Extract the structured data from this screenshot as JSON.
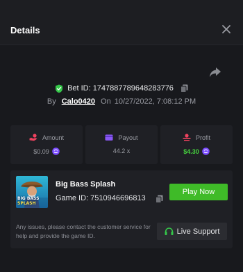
{
  "dialog": {
    "title": "Details",
    "close_icon": "close-icon"
  },
  "bet": {
    "label": "Bet ID:",
    "id": "1747887789648283776",
    "by_label": "By",
    "user": "Calo0420",
    "on_label": "On",
    "date": "10/27/2022, 7:08:12 PM",
    "icons": [
      "shield-check-icon",
      "copy-icon",
      "share-icon"
    ]
  },
  "stats": {
    "amount": {
      "label": "Amount",
      "value": "$0.09",
      "icon": "hand-coins-icon"
    },
    "payout": {
      "label": "Payout",
      "value": "44.2 x",
      "icon": "wallet-icon"
    },
    "profit": {
      "label": "Profit",
      "value": "$4.30",
      "icon": "coins-up-icon"
    }
  },
  "game": {
    "name": "Big Bass Splash",
    "id_label": "Game ID:",
    "id": "7510946696813",
    "thumb_text_1": "BIG BASS",
    "thumb_text_2": "SPLASH",
    "play_label": "Play Now"
  },
  "support": {
    "text": "Any issues, please contact the customer service for help and provide the game ID.",
    "button_label": "Live Support",
    "icon": "headset-icon"
  },
  "colors": {
    "background": "#18191d",
    "card": "#1f2025",
    "accent_green": "#3fbb28",
    "profit_green": "#46d33e",
    "coin_purple": "#7a4bff"
  }
}
